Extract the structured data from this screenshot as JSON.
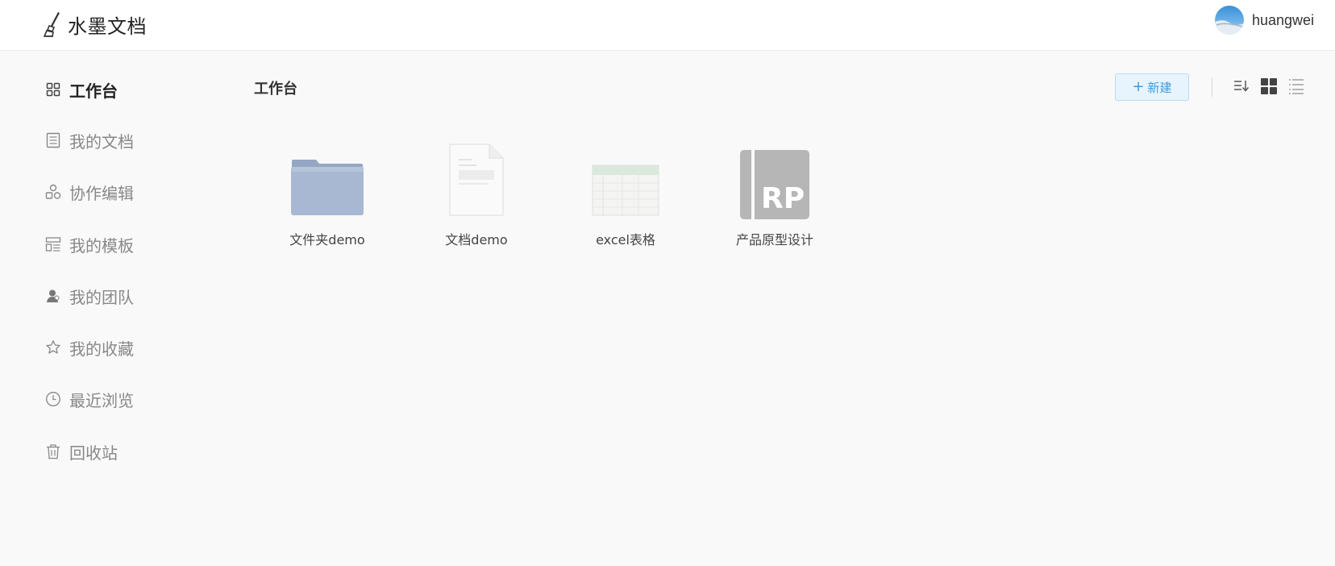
{
  "app": {
    "title": "水墨文档"
  },
  "user": {
    "name": "huangwei"
  },
  "sidebar": {
    "items": [
      {
        "label": "工作台",
        "icon": "grid-icon",
        "active": true
      },
      {
        "label": "我的文档",
        "icon": "document-list-icon"
      },
      {
        "label": "协作编辑",
        "icon": "collaboration-icon"
      },
      {
        "label": "我的模板",
        "icon": "template-icon"
      },
      {
        "label": "我的团队",
        "icon": "team-icon"
      },
      {
        "label": "我的收藏",
        "icon": "star-icon"
      },
      {
        "label": "最近浏览",
        "icon": "clock-icon"
      },
      {
        "label": "回收站",
        "icon": "trash-icon"
      }
    ]
  },
  "main": {
    "title": "工作台",
    "new_button": {
      "plus": "+",
      "label": "新建"
    },
    "files": [
      {
        "name": "文件夹demo",
        "type": "folder"
      },
      {
        "name": "文档demo",
        "type": "document"
      },
      {
        "name": "excel表格",
        "type": "spreadsheet"
      },
      {
        "name": "产品原型设计",
        "type": "prototype",
        "badge": "RP"
      }
    ]
  },
  "colors": {
    "accent": "#3a9be0",
    "folder": "#a4b3cc",
    "rp_tile": "#b8b8b8"
  }
}
